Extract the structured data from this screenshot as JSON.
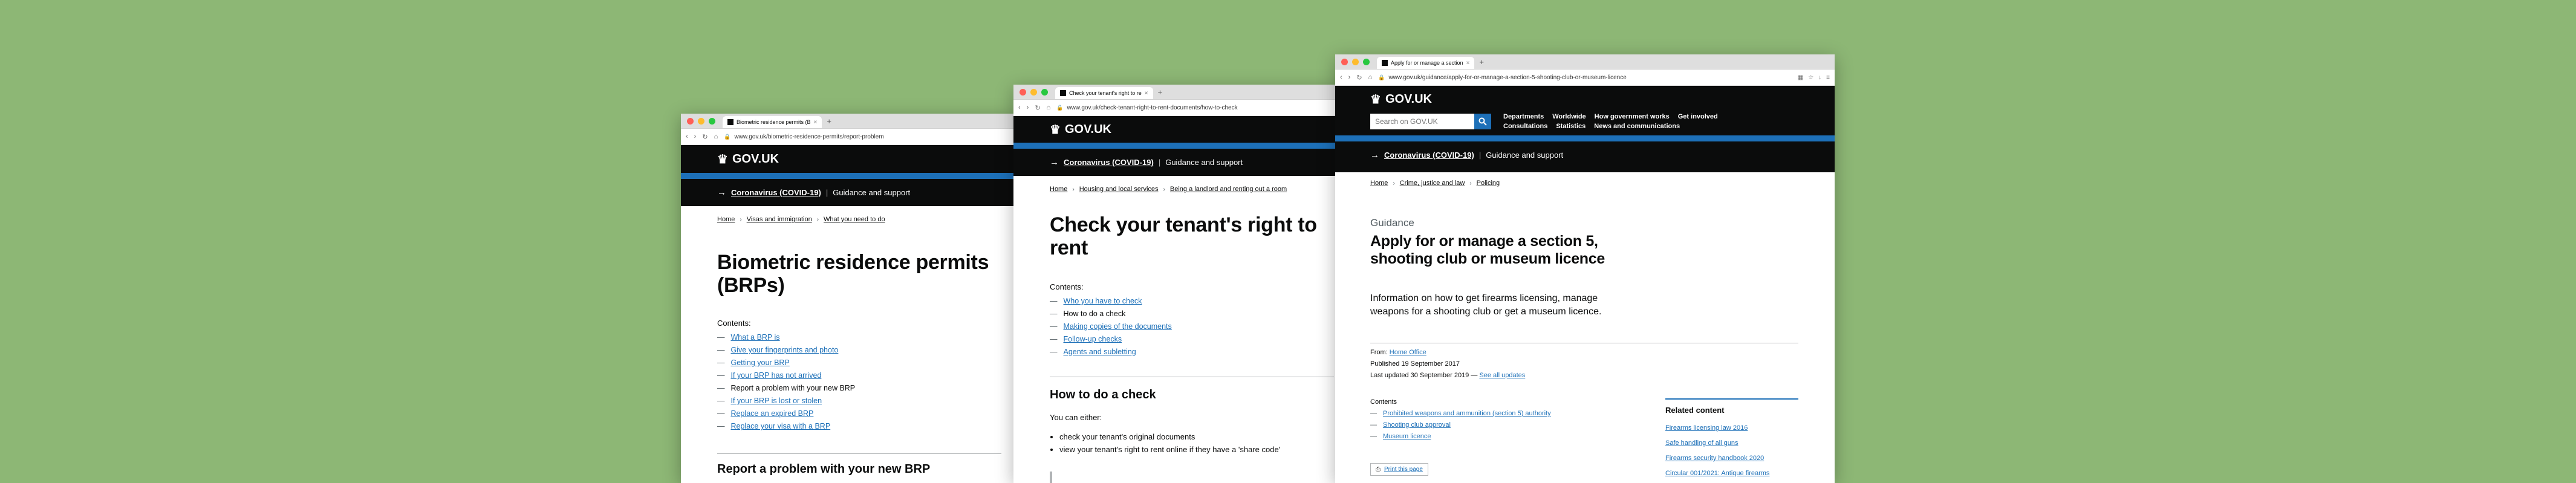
{
  "w1": {
    "tab_title": "Biometric residence permits (B",
    "url": "www.gov.uk/biometric-residence-permits/report-problem",
    "logo": "GOV.UK",
    "covid_link": "Coronavirus (COVID-19)",
    "covid_guidance": "Guidance and support",
    "breadcrumbs": [
      "Home",
      "Visas and immigration",
      "What you need to do"
    ],
    "title": "Biometric residence permits (BRPs)",
    "contents_label": "Contents:",
    "toc": [
      {
        "label": "What a BRP is",
        "current": false
      },
      {
        "label": "Give your fingerprints and photo",
        "current": false
      },
      {
        "label": "Getting your BRP",
        "current": false
      },
      {
        "label": "If your BRP has not arrived",
        "current": false
      },
      {
        "label": "Report a problem with your new BRP",
        "current": true
      },
      {
        "label": "If your BRP is lost or stolen",
        "current": false
      },
      {
        "label": "Replace an expired BRP",
        "current": false
      },
      {
        "label": "Replace your visa with a BRP",
        "current": false
      }
    ],
    "section_heading": "Report a problem with your new BRP"
  },
  "w2": {
    "tab_title": "Check your tenant's right to re",
    "url": "www.gov.uk/check-tenant-right-to-rent-documents/how-to-check",
    "logo": "GOV.UK",
    "covid_link": "Coronavirus (COVID-19)",
    "covid_guidance": "Guidance and support",
    "breadcrumbs": [
      "Home",
      "Housing and local services",
      "Being a landlord and renting out a room"
    ],
    "title": "Check your tenant's right to rent",
    "contents_label": "Contents:",
    "toc": [
      {
        "label": "Who you have to check",
        "current": false
      },
      {
        "label": "How to do a check",
        "current": true
      },
      {
        "label": "Making copies of the documents",
        "current": false
      },
      {
        "label": "Follow-up checks",
        "current": false
      },
      {
        "label": "Agents and subletting",
        "current": false
      }
    ],
    "section_heading": "How to do a check",
    "intro": "You can either:",
    "bullets": [
      "check your tenant's original documents",
      "view your tenant's right to rent online if they have a 'share code'"
    ]
  },
  "w3": {
    "tab_title": "Apply for or manage a section",
    "url": "www.gov.uk/guidance/apply-for-or-manage-a-section-5-shooting-club-or-museum-licence",
    "logo": "GOV.UK",
    "search_placeholder": "Search on GOV.UK",
    "nav_row1": [
      "Departments",
      "Worldwide",
      "How government works",
      "Get involved"
    ],
    "nav_row2": [
      "Consultations",
      "Statistics",
      "News and communications"
    ],
    "covid_link": "Coronavirus (COVID-19)",
    "covid_guidance": "Guidance and support",
    "breadcrumbs": [
      "Home",
      "Crime, justice and law",
      "Policing"
    ],
    "caption": "Guidance",
    "title": "Apply for or manage a section 5, shooting club or museum licence",
    "lead": "Information on how to get firearms licensing, manage weapons for a shooting club or get a museum licence.",
    "from_label": "From:",
    "from_org": "Home Office",
    "published": "Published 19 September 2017",
    "updated": "Last updated 30 September 2019 —",
    "see_updates": "See all updates",
    "contents_label": "Contents",
    "toc": [
      {
        "label": "Prohibited weapons and ammunition (section 5) authority",
        "current": false
      },
      {
        "label": "Shooting club approval",
        "current": false
      },
      {
        "label": "Museum licence",
        "current": false
      }
    ],
    "print_label": "Print this page",
    "related_heading": "Related content",
    "related": [
      "Firearms licensing law 2016",
      "Safe handling of all guns",
      "Firearms security handbook 2020",
      "Circular 001/2021: Antique firearms"
    ]
  }
}
